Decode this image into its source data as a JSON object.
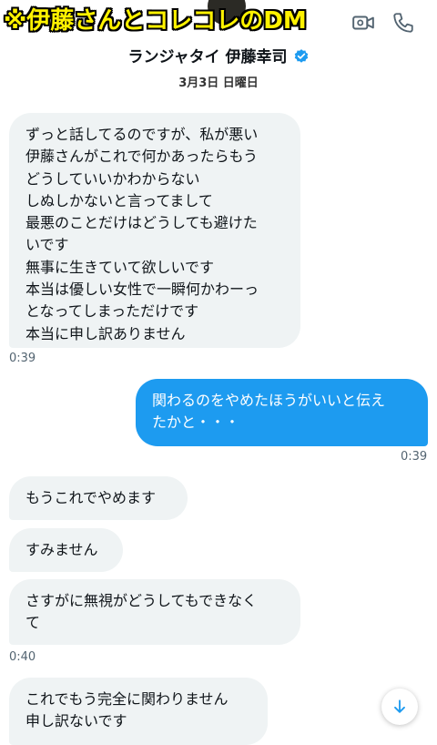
{
  "overlay_caption": "※伊藤さんとコレコレのDM",
  "header": {
    "contact_name": "ランジャタイ 伊藤幸司",
    "date": "3月3日 日曜日",
    "icons": [
      "video-call-icon",
      "phone-call-icon",
      "verified-badge-icon"
    ]
  },
  "colors": {
    "accent": "#1d9bf0",
    "received_bubble": "#eff3f4",
    "caption_text": "#fff200"
  },
  "messages": [
    {
      "direction": "received",
      "lines": [
        "ずっと話してるのですが、私が悪い",
        "伊藤さんがこれで何かあったらもう",
        "どうしていいかわからない",
        "しぬしかないと言ってまして",
        "最悪のことだけはどうしても避けた",
        "いです",
        "無事に生きていて欲しいです",
        "本当は優しい女性で一瞬何かわーっ",
        "となってしまっただけです",
        "本当に申し訳ありません"
      ],
      "time": "0:39"
    },
    {
      "direction": "sent",
      "lines": [
        "関わるのをやめたほうがいいと伝え",
        "たかと・・・"
      ],
      "time": "0:39"
    },
    {
      "direction": "received",
      "lines": [
        "もうこれでやめます"
      ]
    },
    {
      "direction": "received",
      "lines": [
        "すみません"
      ]
    },
    {
      "direction": "received",
      "lines": [
        "さすがに無視がどうしてもできなく",
        "て"
      ],
      "time": "0:40"
    },
    {
      "direction": "received",
      "lines": [
        "これでもう完全に関わりません",
        "申し訳ないです"
      ]
    }
  ],
  "scroll_button": {
    "icon": "arrow-down-icon"
  }
}
